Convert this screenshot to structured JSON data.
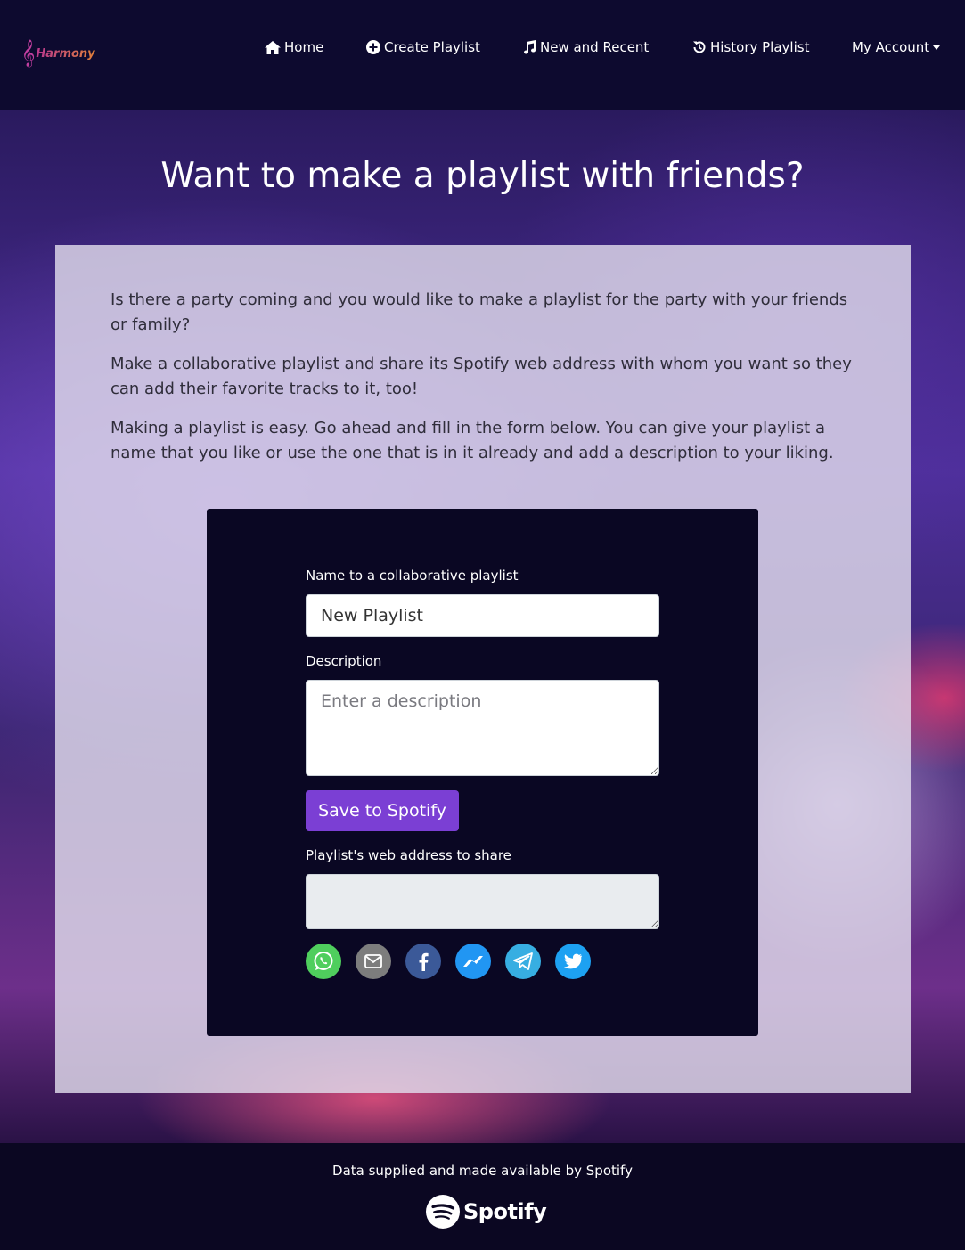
{
  "brand": {
    "clef": "𝄞",
    "name": "Harmony"
  },
  "nav": {
    "home": "Home",
    "create": "Create Playlist",
    "recent": "New and Recent",
    "history": "History Playlist",
    "account": "My Account"
  },
  "hero": {
    "title": "Want to make a playlist with friends?"
  },
  "intro": {
    "p1": "Is there a party coming and you would like to make a playlist for the party with your friends or family?",
    "p2": "Make a collaborative playlist and share its Spotify web address with whom you want so they can add their favorite tracks to it, too!",
    "p3": "Making a playlist is easy. Go ahead and fill in the form below. You can give your playlist a name that you like or use the one that is in it already and add a description to your liking."
  },
  "form": {
    "name_label": "Name to a collaborative playlist",
    "name_value": "New Playlist",
    "desc_label": "Description",
    "desc_placeholder": "Enter a description",
    "save_label": "Save to Spotify",
    "url_label": "Playlist's web address to share",
    "url_value": ""
  },
  "share": [
    {
      "name": "whatsapp-icon",
      "color": "#4fce5d"
    },
    {
      "name": "email-icon",
      "color": "#7d7d7d"
    },
    {
      "name": "facebook-icon",
      "color": "#3b5998"
    },
    {
      "name": "messenger-icon",
      "color": "#2196f3"
    },
    {
      "name": "telegram-icon",
      "color": "#37aee2"
    },
    {
      "name": "twitter-icon",
      "color": "#1da1f2"
    }
  ],
  "footer": {
    "text": "Data supplied and made available by Spotify",
    "logo_text": "Spotify"
  }
}
